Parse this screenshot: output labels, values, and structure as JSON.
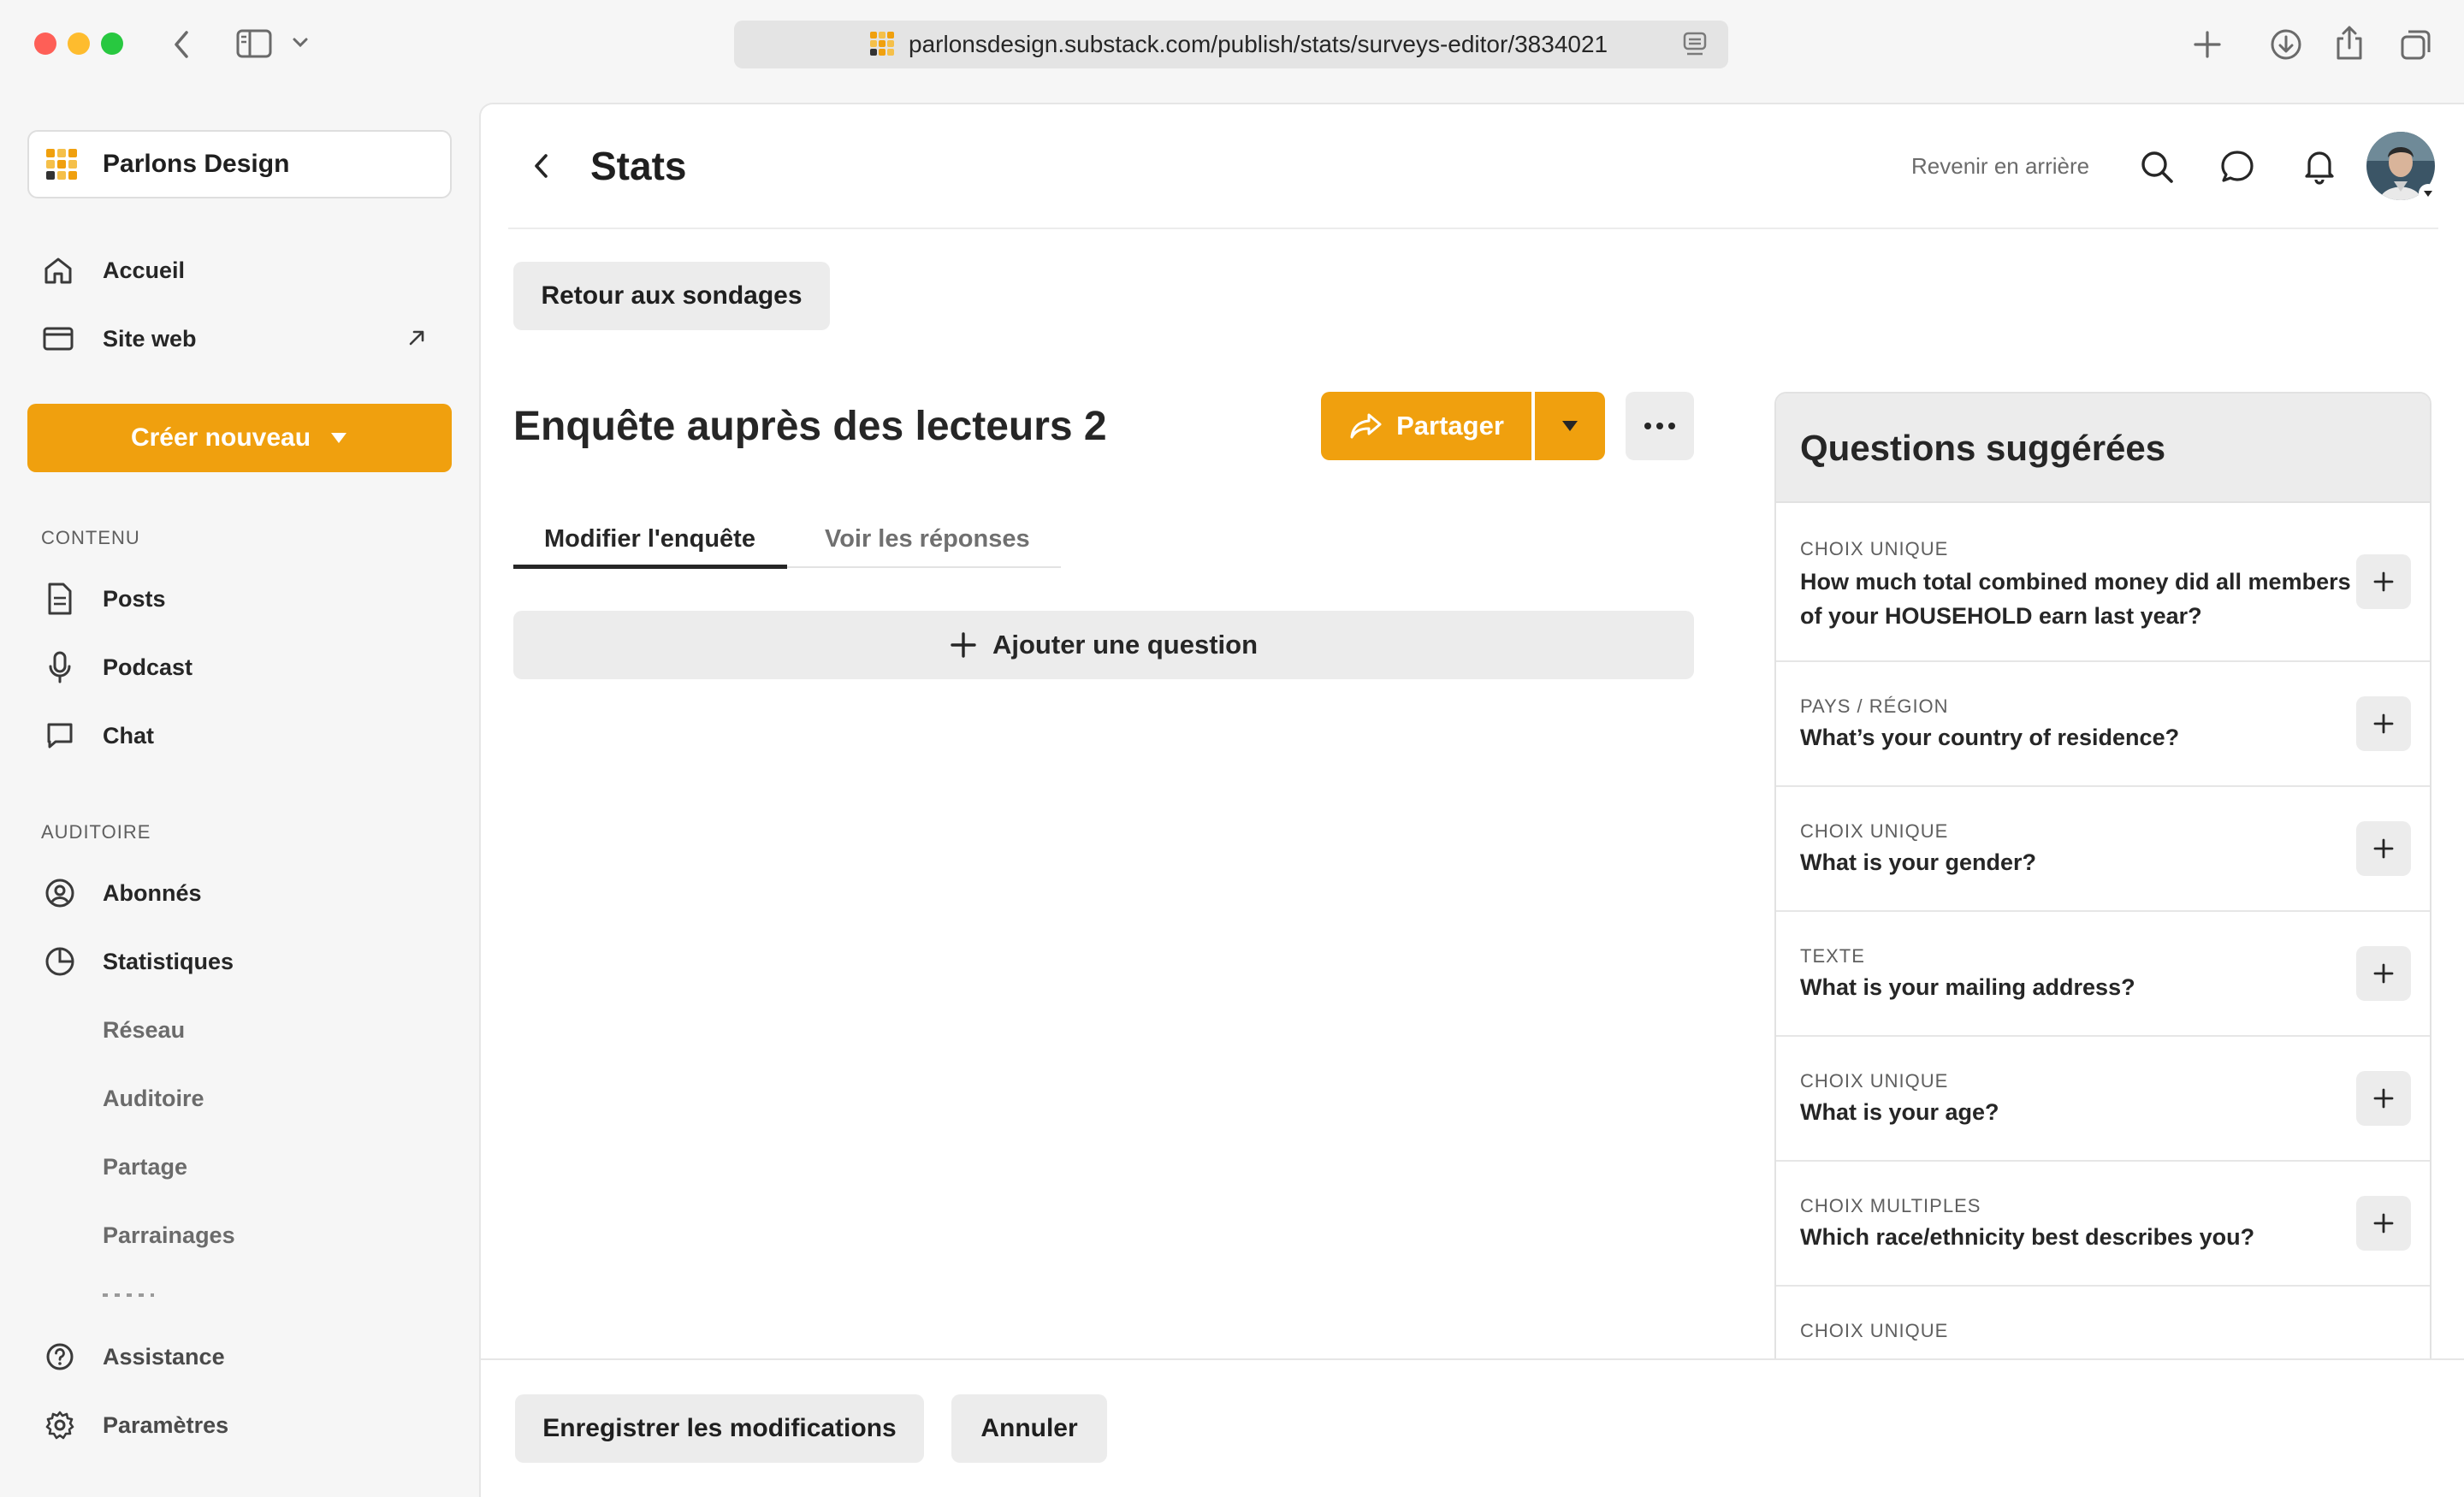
{
  "browser": {
    "url": "parlonsdesign.substack.com/publish/stats/surveys-editor/3834021",
    "colors": {
      "close": "#fe5f57",
      "minimize": "#febc2e",
      "zoom": "#28c840"
    }
  },
  "sidebar": {
    "publication_name": "Parlons Design",
    "nav": {
      "home": "Accueil",
      "website": "Site web"
    },
    "create_button": "Créer nouveau",
    "content_section": {
      "label": "CONTENU",
      "items": {
        "posts": "Posts",
        "podcast": "Podcast",
        "chat": "Chat"
      }
    },
    "audience_section": {
      "label": "AUDITOIRE",
      "subscribers": "Abonnés",
      "stats": "Statistiques",
      "stats_sub": [
        "Réseau",
        "Auditoire",
        "Partage",
        "Parrainages"
      ]
    },
    "footer": {
      "support": "Assistance",
      "settings": "Paramètres"
    }
  },
  "header": {
    "title": "Stats",
    "back_link": "Revenir en arrière"
  },
  "main": {
    "back_to_surveys": "Retour aux sondages",
    "survey_title": "Enquête auprès des lecteurs 2",
    "share_button": "Partager",
    "tabs": [
      {
        "label": "Modifier l'enquête",
        "active": true
      },
      {
        "label": "Voir les réponses",
        "active": false
      }
    ],
    "add_question": "Ajouter une question",
    "save_button": "Enregistrer les modifications",
    "cancel_button": "Annuler"
  },
  "suggested": {
    "title": "Questions suggérées",
    "items": [
      {
        "type": "CHOIX UNIQUE",
        "question": "How much total combined money did all members of your HOUSEHOLD earn last year?"
      },
      {
        "type": "PAYS / RÉGION",
        "question": "What’s your country of residence?"
      },
      {
        "type": "CHOIX UNIQUE",
        "question": "What is your gender?"
      },
      {
        "type": "TEXTE",
        "question": "What is your mailing address?"
      },
      {
        "type": "CHOIX UNIQUE",
        "question": "What is your age?"
      },
      {
        "type": "CHOIX MULTIPLES",
        "question": "Which race/ethnicity best describes you?"
      },
      {
        "type": "CHOIX UNIQUE",
        "question": ""
      }
    ]
  },
  "accent_color": "#f0a00e"
}
